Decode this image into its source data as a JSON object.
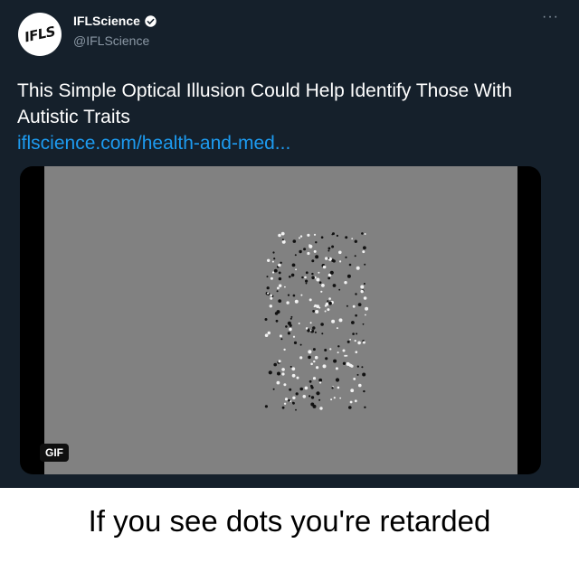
{
  "account": {
    "avatar_text": "IFLS",
    "display_name": "IFLScience",
    "handle": "@IFLScience",
    "verified": true
  },
  "tweet": {
    "text": "This Simple Optical Illusion Could Help Identify Those With Autistic Traits",
    "link_text": "iflscience.com/health-and-med...",
    "media_badge": "GIF"
  },
  "caption": {
    "text": "If you see dots you're retarded"
  },
  "colors": {
    "background": "#15202b",
    "link": "#1d9bf0",
    "media_gray": "#818181"
  }
}
